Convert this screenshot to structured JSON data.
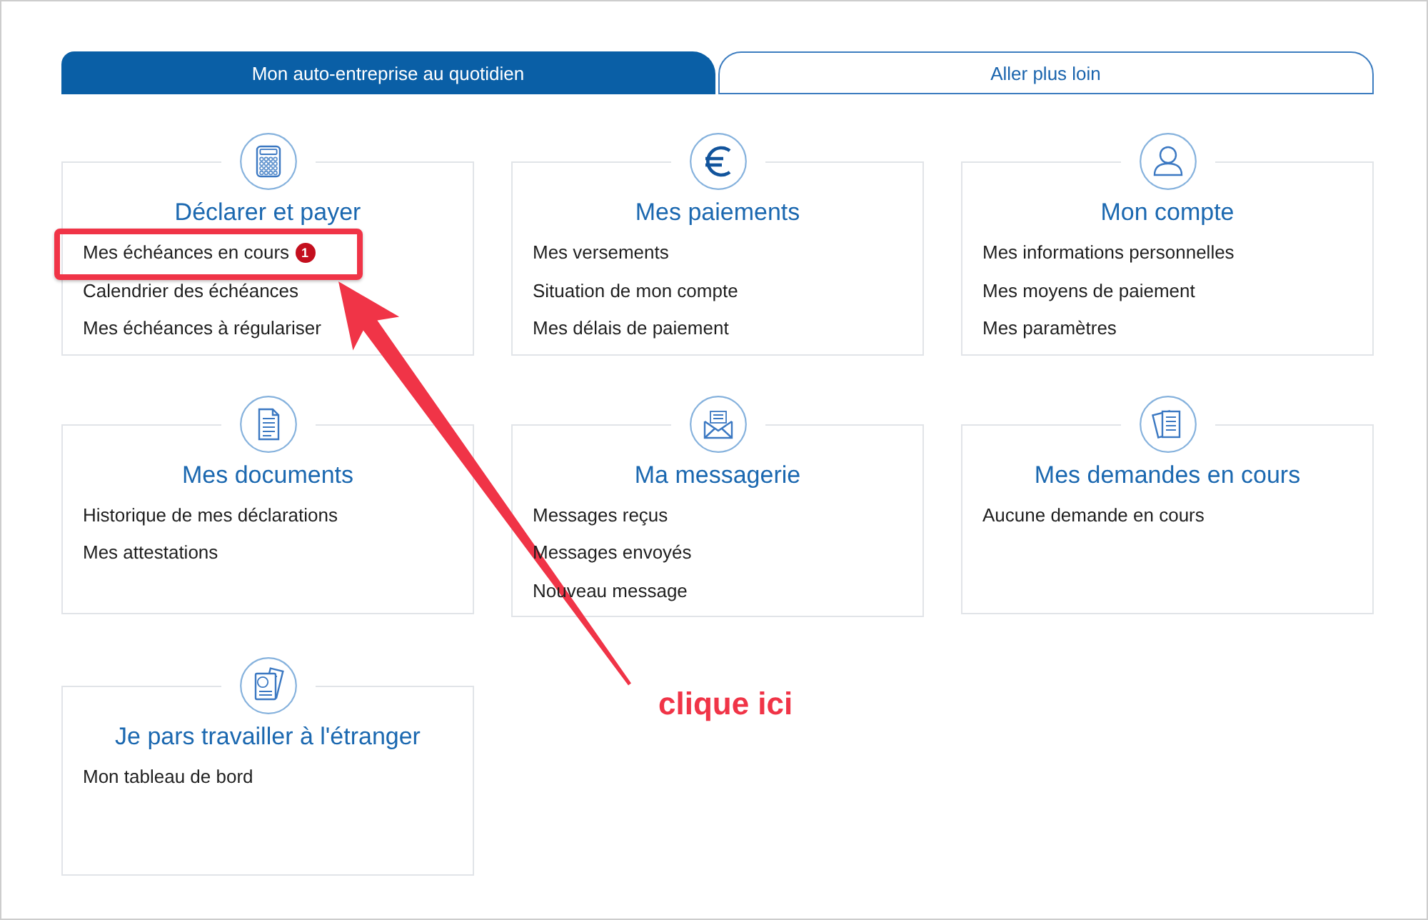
{
  "tabs": [
    {
      "label": "Mon auto-entreprise au quotidien",
      "selected": true
    },
    {
      "label": "Aller plus loin",
      "selected": false
    }
  ],
  "cards": [
    {
      "title": "Déclarer et payer",
      "links": [
        {
          "label": "Mes échéances en cours",
          "badge": "1",
          "highlighted": true
        },
        {
          "label": "Calendrier des échéances",
          "highlighted": false
        },
        {
          "label": "Mes échéances à régulariser",
          "highlighted": false
        }
      ]
    },
    {
      "title": "Mes paiements",
      "links": [
        {
          "label": "Mes versements",
          "highlighted": false
        },
        {
          "label": "Situation de mon compte",
          "highlighted": false
        },
        {
          "label": "Mes délais de paiement",
          "highlighted": false
        }
      ]
    },
    {
      "title": "Mon compte",
      "links": [
        {
          "label": "Mes informations personnelles",
          "highlighted": false
        },
        {
          "label": "Mes moyens de paiement",
          "highlighted": false
        },
        {
          "label": "Mes paramètres",
          "highlighted": false
        }
      ]
    },
    {
      "title": "Mes documents",
      "links": [
        {
          "label": "Historique de mes déclarations",
          "highlighted": false
        },
        {
          "label": "Mes attestations",
          "highlighted": false
        }
      ]
    },
    {
      "title": "Ma messagerie",
      "links": [
        {
          "label": "Messages reçus",
          "highlighted": false
        },
        {
          "label": "Messages envoyés",
          "highlighted": false
        },
        {
          "label": "Nouveau message",
          "highlighted": false
        }
      ]
    },
    {
      "title": "Mes demandes en cours",
      "links": [
        {
          "label": "Aucune demande en cours",
          "highlighted": false
        }
      ]
    },
    {
      "title": "Je pars travailler à l'étranger",
      "links": [
        {
          "label": "Mon tableau de bord",
          "highlighted": false
        }
      ]
    }
  ],
  "annotation": {
    "caption": "clique ici"
  }
}
